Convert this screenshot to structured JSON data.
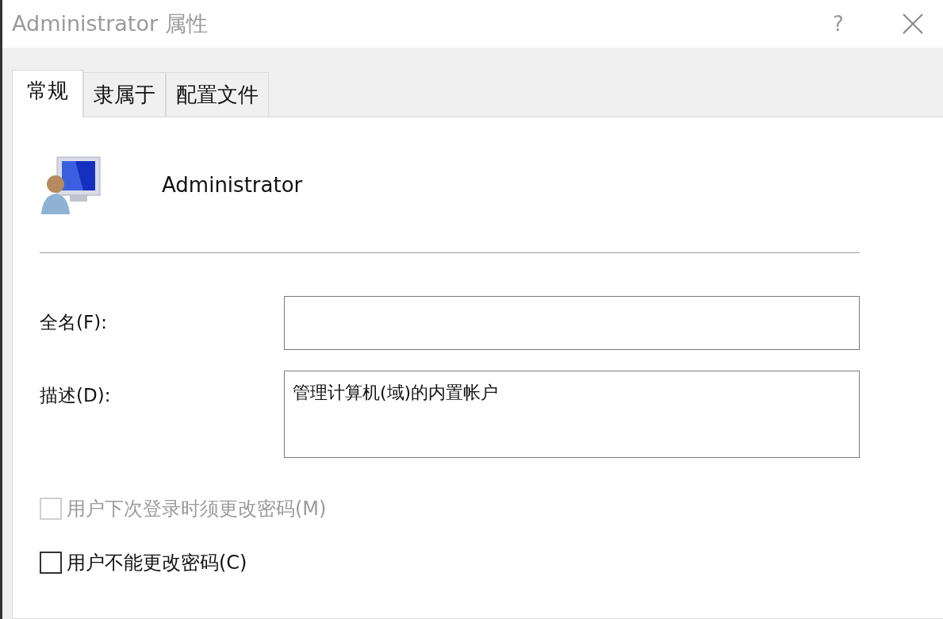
{
  "window": {
    "title": "Administrator 属性",
    "help": "?"
  },
  "tabs": [
    {
      "label": "常规",
      "selected": true
    },
    {
      "label": "隶属于",
      "selected": false
    },
    {
      "label": "配置文件",
      "selected": false
    }
  ],
  "user": {
    "name": "Administrator"
  },
  "fields": [
    {
      "label": "全名(F):",
      "kind": "line"
    },
    {
      "label": "描述(D):",
      "value": "管理计算机(域)的内置帐户",
      "kind": "area"
    }
  ],
  "options": [
    {
      "label": "用户下次登录时须更改密码(M)",
      "checked": false,
      "disabled": true
    },
    {
      "label": "用户不能更改密码(C)",
      "checked": false,
      "disabled": false
    }
  ]
}
